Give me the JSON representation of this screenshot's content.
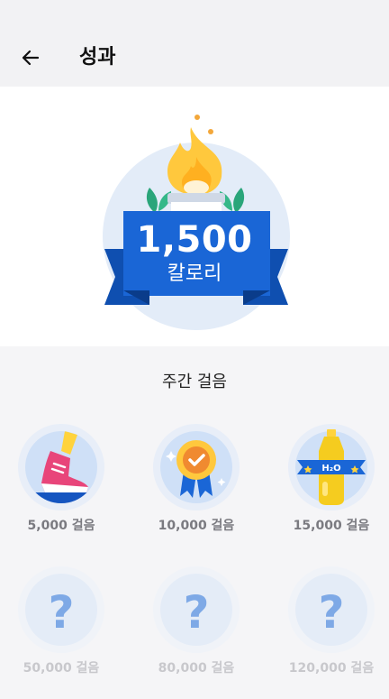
{
  "header": {
    "title": "성과",
    "back_icon": "arrow-left-icon"
  },
  "hero": {
    "value": "1,500",
    "unit": "칼로리",
    "icon": "flame-trophy-icon"
  },
  "weekly": {
    "title": "주간 걸음",
    "badges": [
      {
        "label": "5,000 걸음",
        "unlocked": true,
        "icon": "sneaker-icon"
      },
      {
        "label": "10,000 걸음",
        "unlocked": true,
        "icon": "medal-check-icon"
      },
      {
        "label": "15,000 걸음",
        "unlocked": true,
        "icon": "water-bottle-icon",
        "bottle_text": "H₂O"
      },
      {
        "label": "50,000 걸음",
        "unlocked": false,
        "icon": "question-icon",
        "mark": "?"
      },
      {
        "label": "80,000 걸음",
        "unlocked": false,
        "icon": "question-icon",
        "mark": "?"
      },
      {
        "label": "120,000 걸음",
        "unlocked": false,
        "icon": "question-icon",
        "mark": "?"
      }
    ]
  },
  "colors": {
    "primary_blue": "#1a66d6",
    "light_blue": "#e3ecf8",
    "flame": "#ffc83d",
    "leaf": "#2aa57a"
  }
}
